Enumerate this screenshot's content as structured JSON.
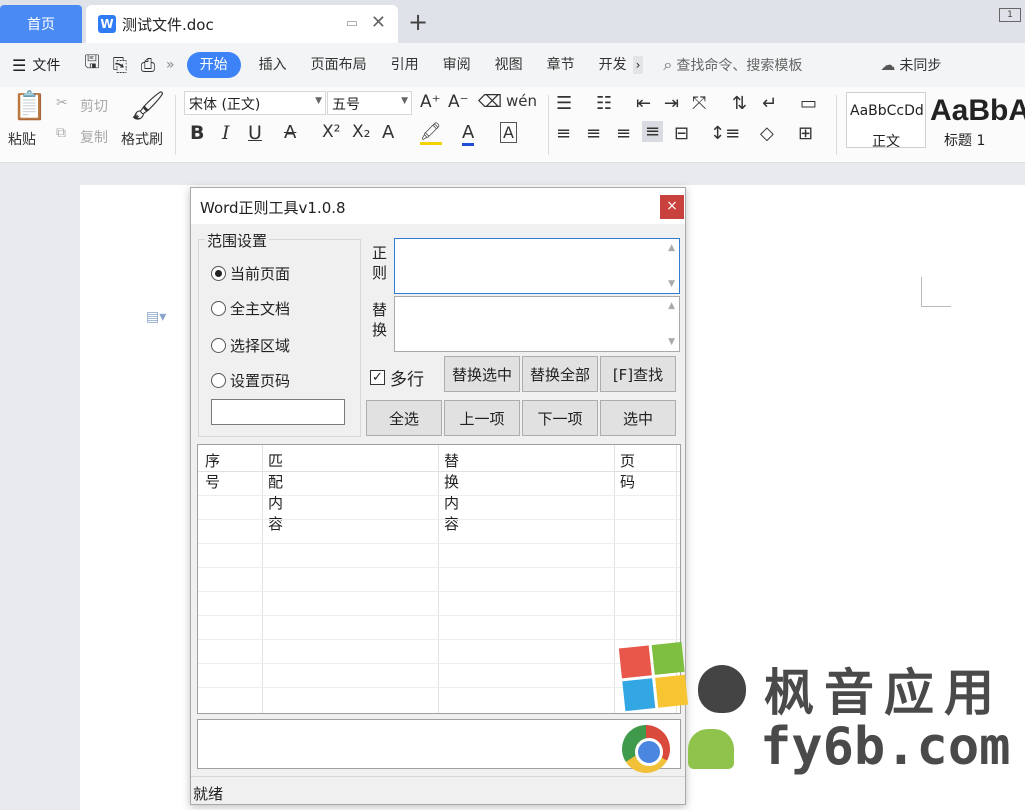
{
  "tabs": {
    "home": "首页",
    "doc_title": "测试文件.doc",
    "add": "+",
    "close": "✕",
    "window_ctl": "1"
  },
  "menu": {
    "file": "文件",
    "tabs": [
      "开始",
      "插入",
      "页面布局",
      "引用",
      "审阅",
      "视图",
      "章节",
      "开发"
    ],
    "active_index": 0,
    "search_placeholder": "查找命令、搜索模板",
    "sync": "未同步"
  },
  "ribbon": {
    "paste": "粘贴",
    "cut": "剪切",
    "copy": "复制",
    "format_painter": "格式刷",
    "font_name": "宋体 (正文)",
    "font_size": "五号",
    "bold": "B",
    "italic": "I",
    "underline": "U",
    "style_normal_sample": "AaBbCcDd",
    "style_normal_name": "正文",
    "style_h1_sample": "AaBbA",
    "style_h1_name": "标题 1"
  },
  "dialog": {
    "title": "Word正则工具v1.0.8",
    "close": "×",
    "scope_title": "范围设置",
    "scope_options": [
      "当前页面",
      "全主文档",
      "选择区域",
      "设置页码"
    ],
    "scope_selected": 0,
    "regex_label": "正则",
    "replace_label": "替换",
    "multiline_label": "多行",
    "multiline_checked": true,
    "buttons": {
      "replace_selected": "替换选中",
      "replace_all": "替换全部",
      "find": "[F]查找",
      "select_all": "全选",
      "prev": "上一项",
      "next": "下一项",
      "select": "选中"
    },
    "table_headers": [
      "序号",
      "匹配内容",
      "替换内容",
      "页码"
    ],
    "status": "就绪"
  },
  "watermark": {
    "cn": "枫音应用",
    "url": "fy6b.com"
  },
  "colors": {
    "accent": "#3d82f6",
    "close_red": "#c8413d"
  }
}
